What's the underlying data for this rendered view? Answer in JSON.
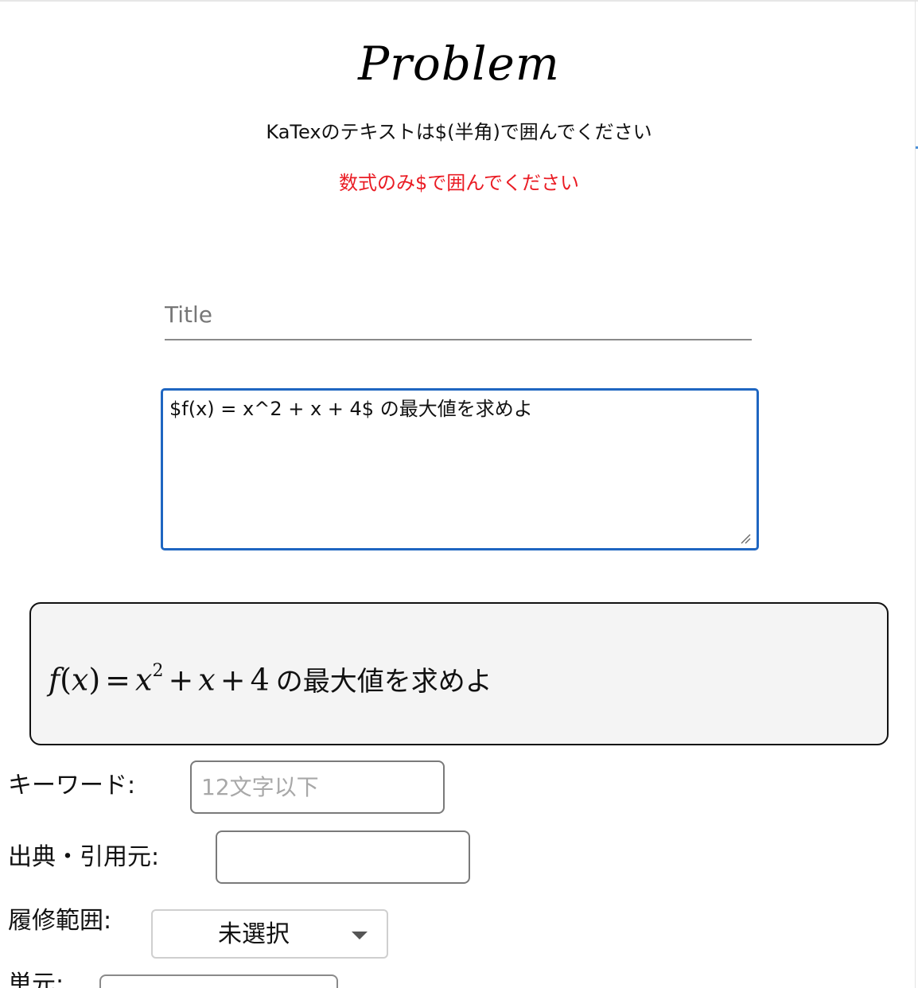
{
  "header": {
    "title": "Problem",
    "instruction": "KaTexのテキストは$(半角)で囲んでください",
    "warning": "数式のみ$で囲んでください",
    "warning_color": "#ea1c24"
  },
  "form": {
    "title_placeholder": "Title",
    "problem_text": "$f(x) = x^2 + x + 4$ の最大値を求めよ",
    "problem_border_color": "#1f66c1"
  },
  "preview": {
    "math_f": "f",
    "math_x1": "x",
    "math_eq": "=",
    "math_x2": "x",
    "math_exp": "2",
    "math_plus1": "+",
    "math_x3": "x",
    "math_plus2": "+",
    "math_four": "4",
    "suffix": "の最大値を求めよ"
  },
  "fields": {
    "keyword_label": "キーワード:",
    "keyword_placeholder": "12文字以下",
    "source_label": "出典・引用元:",
    "source_value": "",
    "range_label": "履修範囲:",
    "range_selected": "未選択",
    "unit_label": "単元:"
  },
  "icons": {
    "resize": "resize-grip-icon",
    "caret": "chevron-down-icon"
  }
}
